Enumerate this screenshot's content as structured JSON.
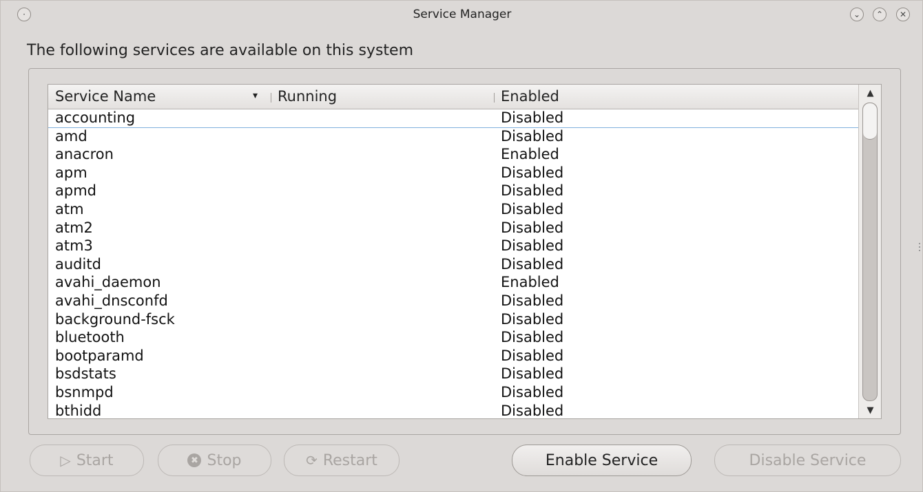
{
  "window": {
    "title": "Service Manager",
    "controls": {
      "minimize_icon": "⌄",
      "maximize_icon": "⌃",
      "close_icon": "✕"
    },
    "menu_icon": "·"
  },
  "heading": "The following services are available on this system",
  "table": {
    "columns": [
      "Service Name",
      "Running",
      "Enabled"
    ],
    "sort_icon": "▾",
    "rows": [
      {
        "name": "accounting",
        "running": "",
        "enabled": "Disabled"
      },
      {
        "name": "amd",
        "running": "",
        "enabled": "Disabled"
      },
      {
        "name": "anacron",
        "running": "",
        "enabled": "Enabled"
      },
      {
        "name": "apm",
        "running": "",
        "enabled": "Disabled"
      },
      {
        "name": "apmd",
        "running": "",
        "enabled": "Disabled"
      },
      {
        "name": "atm",
        "running": "",
        "enabled": "Disabled"
      },
      {
        "name": "atm2",
        "running": "",
        "enabled": "Disabled"
      },
      {
        "name": "atm3",
        "running": "",
        "enabled": "Disabled"
      },
      {
        "name": "auditd",
        "running": "",
        "enabled": "Disabled"
      },
      {
        "name": "avahi_daemon",
        "running": "",
        "enabled": "Enabled"
      },
      {
        "name": "avahi_dnsconfd",
        "running": "",
        "enabled": "Disabled"
      },
      {
        "name": "background-fsck",
        "running": "",
        "enabled": "Disabled"
      },
      {
        "name": "bluetooth",
        "running": "",
        "enabled": "Disabled"
      },
      {
        "name": "bootparamd",
        "running": "",
        "enabled": "Disabled"
      },
      {
        "name": "bsdstats",
        "running": "",
        "enabled": "Disabled"
      },
      {
        "name": "bsnmpd",
        "running": "",
        "enabled": "Disabled"
      },
      {
        "name": "bthidd",
        "running": "",
        "enabled": "Disabled"
      }
    ],
    "scroll_up_icon": "▲",
    "scroll_down_icon": "▼"
  },
  "buttons": {
    "start": {
      "label": "Start",
      "icon": "▷",
      "enabled": false
    },
    "stop": {
      "label": "Stop",
      "icon": "✖",
      "enabled": false
    },
    "restart": {
      "label": "Restart",
      "icon": "⟳",
      "enabled": false
    },
    "enable_service": {
      "label": "Enable Service",
      "enabled": true
    },
    "disable_service": {
      "label": "Disable Service",
      "enabled": false
    }
  }
}
